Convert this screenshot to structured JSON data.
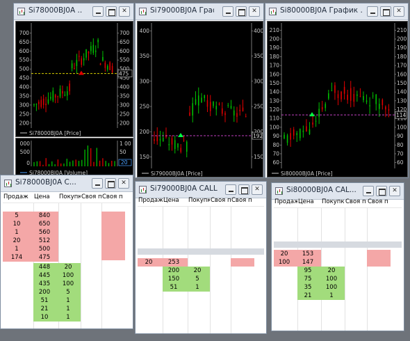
{
  "windows": {
    "chart1": {
      "title": "Si78000BJ0A ...",
      "price_legend": "Si78000BJ0A [Price]",
      "volume_legend": "Si78000BJ0A [Volume]",
      "price_marker": "475",
      "vol_marker": "20"
    },
    "chart2": {
      "title": "Si79000BJ0A Граф...",
      "price_legend": "Si79000BJ0A [Price]",
      "price_marker": "192"
    },
    "chart3": {
      "title": "Si80000BJ0A График ...",
      "price_legend": "Si80000BJ0A [Price]",
      "price_marker": "114"
    },
    "quote1": {
      "title": "Si78000BJ0A C..."
    },
    "quote2": {
      "title": "Si79000BJ0A CALL ..."
    },
    "quote3": {
      "title": "Si80000BJ0A CAL..."
    }
  },
  "table_headers": [
    "Продаж",
    "Цена",
    "Покупка",
    "Своя п",
    "Своя п"
  ],
  "quote1_rows": [
    {
      "sell": "5",
      "price": "840"
    },
    {
      "sell": "10",
      "price": "650"
    },
    {
      "sell": "1",
      "price": "560"
    },
    {
      "sell": "20",
      "price": "512"
    },
    {
      "sell": "1",
      "price": "500"
    },
    {
      "sell": "174",
      "price": "475"
    },
    {
      "price": "448",
      "buy": "20"
    },
    {
      "price": "445",
      "buy": "100"
    },
    {
      "price": "435",
      "buy": "100"
    },
    {
      "price": "200",
      "buy": "5"
    },
    {
      "price": "51",
      "buy": "1"
    },
    {
      "price": "21",
      "buy": "1"
    },
    {
      "price": "10",
      "buy": "1"
    }
  ],
  "quote2_rows": [
    {
      "sell": "20",
      "price": "253"
    },
    {
      "price": "200",
      "buy": "20"
    },
    {
      "price": "150",
      "buy": "5"
    },
    {
      "price": "51",
      "buy": "1"
    }
  ],
  "quote3_rows": [
    {
      "sell": "20",
      "price": "153"
    },
    {
      "sell": "100",
      "price": "147"
    },
    {
      "price": "95",
      "buy": "20"
    },
    {
      "price": "75",
      "buy": "100"
    },
    {
      "price": "35",
      "buy": "100"
    },
    {
      "price": "21",
      "buy": "1"
    }
  ],
  "chart_data": [
    {
      "type": "candlestick",
      "series_name": "Si78000BJ0A [Price]",
      "yticks": [
        "700",
        "650",
        "600",
        "550",
        "500",
        "450",
        "400",
        "350",
        "300",
        "250",
        "200"
      ],
      "ylim": [
        180,
        740
      ],
      "last": 475,
      "colors": {
        "up": "#00b000",
        "down": "#e00000",
        "marker_line": "#d8d000"
      }
    },
    {
      "type": "bar",
      "series_name": "Si78000BJ0A [Volume]",
      "yticks": [
        "000",
        "500",
        "0"
      ],
      "right_ticks": [
        "1 00",
        "50"
      ],
      "last": 20
    },
    {
      "type": "candlestick",
      "series_name": "Si79000BJ0A [Price]",
      "yticks": [
        "400",
        "350",
        "300",
        "250",
        "200",
        "150"
      ],
      "ylim": [
        130,
        410
      ],
      "last": 192,
      "colors": {
        "marker_line": "#c040c0"
      }
    },
    {
      "type": "candlestick",
      "series_name": "Si80000BJ0A [Price]",
      "yticks": [
        "210",
        "200",
        "190",
        "180",
        "170",
        "160",
        "150",
        "140",
        "130",
        "120",
        "110",
        "100",
        "90",
        "80",
        "70",
        "60"
      ],
      "ylim": [
        55,
        215
      ],
      "last": 114,
      "colors": {
        "marker_line": "#c040c0"
      }
    }
  ]
}
